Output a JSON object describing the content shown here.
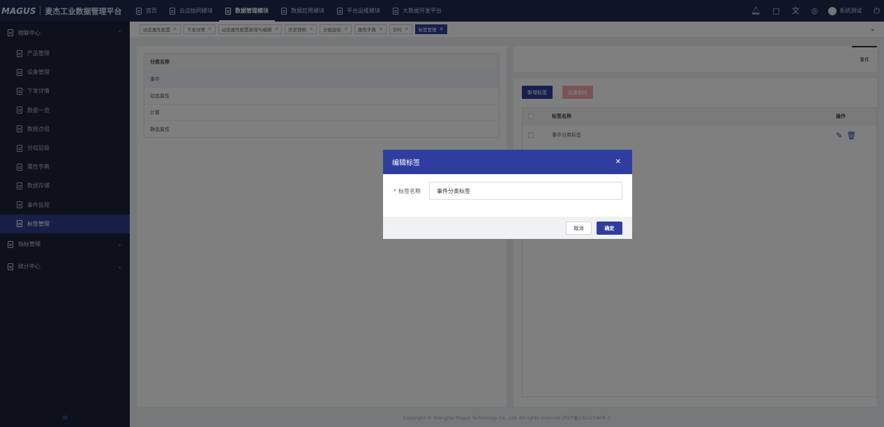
{
  "brand": {
    "logo": "MAGUS",
    "name": "麦杰工业数据管理平台"
  },
  "nav": [
    {
      "label": "首页",
      "active": false
    },
    {
      "label": "云边协同模块",
      "active": false
    },
    {
      "label": "数据管理模块",
      "active": true
    },
    {
      "label": "数据应用模块",
      "active": false
    },
    {
      "label": "平台运维模块",
      "active": false
    },
    {
      "label": "大数据开发平台",
      "active": false
    }
  ],
  "user": {
    "name": "系统测试"
  },
  "sidebar": {
    "group1": "物联中心",
    "items": [
      {
        "label": "产品管理",
        "active": false
      },
      {
        "label": "设备管理",
        "active": false
      },
      {
        "label": "下发详情",
        "active": false
      },
      {
        "label": "数据一览",
        "active": false
      },
      {
        "label": "数据点组",
        "active": false
      },
      {
        "label": "分组层级",
        "active": false
      },
      {
        "label": "属性字典",
        "active": false
      },
      {
        "label": "数据存储",
        "active": false
      },
      {
        "label": "事件监视",
        "active": false
      },
      {
        "label": "标签管理",
        "active": true
      }
    ],
    "group2": "指标管理",
    "group3": "统计中心"
  },
  "tabs": [
    {
      "label": "动态属性配置",
      "active": false
    },
    {
      "label": "下发详情",
      "active": false
    },
    {
      "label": "动态属性配置新增与编辑",
      "active": false
    },
    {
      "label": "历史快照",
      "active": false
    },
    {
      "label": "分组层级",
      "active": false
    },
    {
      "label": "属性字典",
      "active": false
    },
    {
      "label": "实时",
      "active": false
    },
    {
      "label": "标签管理",
      "active": true
    }
  ],
  "category_table": {
    "header": "分类名称",
    "rows": [
      "事件",
      "动态属性",
      "计算",
      "静态属性"
    ],
    "selected_index": 0
  },
  "right_panel": {
    "tab_label": "事件",
    "add_button": "新增标签",
    "batch_delete_button": "批量删除",
    "columns": {
      "name": "标签名称",
      "operation": "操作"
    },
    "rows": [
      {
        "name": "事件分类标签"
      }
    ]
  },
  "footer": "Copyright © Shanghai Magus Technology Co., Ltd. All rights reserved    沪ICP备13012546号-3",
  "modal": {
    "title": "编辑标签",
    "required_mark": "*",
    "field_label": "标签名称",
    "field_value": "事件分类标签",
    "cancel": "取消",
    "confirm": "确定"
  },
  "colors": {
    "primary": "#2f3e9e",
    "topbar": "#1b2a4e",
    "sidebar": "#1b2338",
    "danger_light": "#f2a9a9"
  }
}
